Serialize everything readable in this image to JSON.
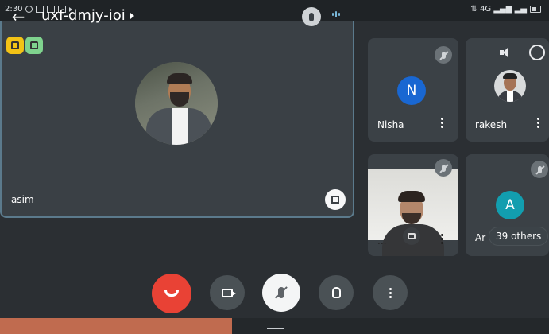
{
  "status_bar": {
    "time": "2:30",
    "right_text": "⇅ 4G ▂▄▆ ▂▄"
  },
  "meeting": {
    "code": "uxf-dmjy-ioi"
  },
  "main_tile": {
    "name": "asim"
  },
  "participants": {
    "nisha": {
      "name": "Nisha",
      "initial": "N",
      "color": "#1967d2"
    },
    "rakesh": {
      "name": "rakesh"
    },
    "video_user": {
      "name": "..."
    },
    "ar": {
      "name": "Ar",
      "initial": "A",
      "color": "#129eaf"
    }
  },
  "others": {
    "label": "39 others"
  },
  "icons": {
    "back": "arrow-left-icon",
    "mic_top": "mic-icon",
    "audio": "audio-level-icon",
    "speaker": "speaker-icon",
    "switch_camera": "switch-camera-icon",
    "end_call": "end-call-icon",
    "camera": "camera-icon",
    "mic_off": "mic-off-icon",
    "raise_hand": "raise-hand-icon",
    "more": "more-vert-icon"
  },
  "colors": {
    "end_call": "#e94235",
    "chip_yellow": "#f3c316",
    "chip_green": "#7fd38e",
    "active_border": "#5b7a8c"
  }
}
